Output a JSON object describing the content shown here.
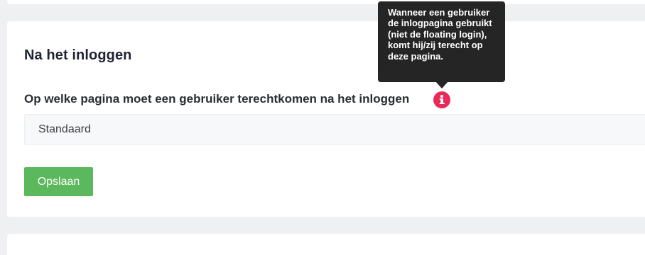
{
  "section": {
    "title": "Na het inloggen"
  },
  "field": {
    "label": "Op welke pagina moet een gebruiker terechtkomen na het inloggen",
    "info_icon": "info-icon",
    "select_value": "Standaard"
  },
  "tooltip": {
    "text": "Wanneer een gebruiker de inlogpagina gebruikt (niet de floating login), komt hij/zij terecht op deze pagina."
  },
  "actions": {
    "save_label": "Opslaan"
  },
  "colors": {
    "accent_info": "#e8295a",
    "save_button": "#5cb85c",
    "tooltip_bg": "#252525"
  }
}
